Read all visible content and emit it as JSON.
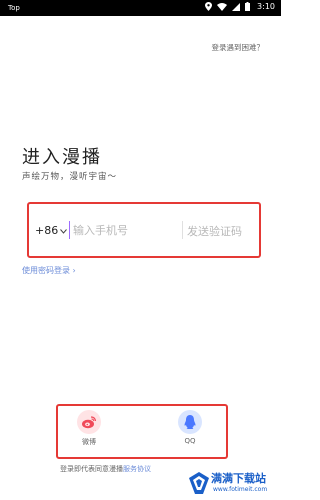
{
  "status_bar": {
    "app_label": "Top",
    "time": "3:10",
    "icons": [
      "location-icon",
      "wifi-icon",
      "signal-icon",
      "battery-icon"
    ]
  },
  "header": {
    "help_link": "登录遇到困难？"
  },
  "main": {
    "title": "进入漫播",
    "subtitle": "声绘万物，漫听宇宙～"
  },
  "phone_form": {
    "country_code": "+86",
    "phone_placeholder": "输入手机号",
    "phone_value": "",
    "send_code_label": "发送验证码"
  },
  "password_login": {
    "label": "使用密码登录 ›"
  },
  "social": {
    "items": [
      {
        "label": "微博",
        "icon": "weibo-icon"
      },
      {
        "label": "QQ",
        "icon": "qq-icon"
      }
    ]
  },
  "footer": {
    "agreement_prefix": "登录即代表同意漫播",
    "agreement_link": "服务协议"
  },
  "watermark": {
    "title": "满满下载站",
    "url": "www.fotimeit.com"
  },
  "colors": {
    "highlight": "#e53935",
    "link": "#6c8cd8",
    "weibo_bg": "#ffe3e5",
    "qq_bg": "#d9e5ff",
    "cursor": "#9d6cff"
  }
}
